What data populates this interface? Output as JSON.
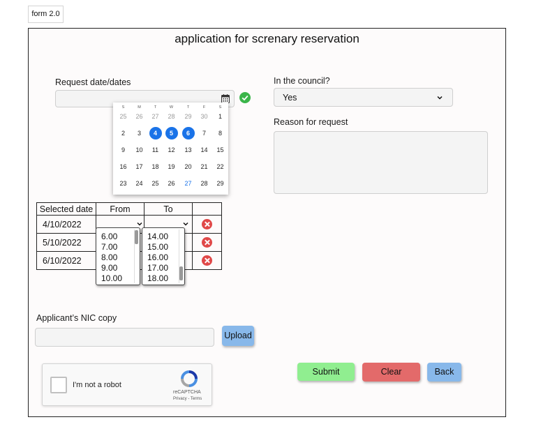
{
  "version_tag": "form 2.0",
  "title": "application for screnary reservation",
  "request_date": {
    "label": "Request date/dates",
    "value": ""
  },
  "council": {
    "label": "In the council?",
    "selected": "Yes"
  },
  "reason": {
    "label": "Reason for request",
    "value": ""
  },
  "calendar": {
    "weekdays": [
      "S",
      "M",
      "T",
      "W",
      "T",
      "F",
      "S"
    ],
    "rows": [
      [
        "25",
        "26",
        "27",
        "28",
        "29",
        "30",
        "1"
      ],
      [
        "2",
        "3",
        "4",
        "5",
        "6",
        "7",
        "8"
      ],
      [
        "9",
        "10",
        "11",
        "12",
        "13",
        "14",
        "15"
      ],
      [
        "16",
        "17",
        "18",
        "19",
        "20",
        "21",
        "22"
      ],
      [
        "23",
        "24",
        "25",
        "26",
        "27",
        "28",
        "29"
      ]
    ],
    "selected_days": [
      "4",
      "5",
      "6"
    ],
    "today": "27"
  },
  "table": {
    "headers": [
      "Selected date",
      "From",
      "To"
    ],
    "rows": [
      {
        "date": "4/10/2022"
      },
      {
        "date": "5/10/2022"
      },
      {
        "date": "6/10/2022"
      }
    ]
  },
  "from_options": [
    "6.00",
    "7.00",
    "8.00",
    "9.00",
    "10.00"
  ],
  "to_options": [
    "14.00",
    "15.00",
    "16.00",
    "17.00",
    "18.00"
  ],
  "nic": {
    "label": "Applicant’s NIC copy",
    "upload_label": "Upload"
  },
  "captcha": {
    "text": "I'm not a robot",
    "brand": "reCAPTCHA",
    "links": "Privacy - Terms"
  },
  "buttons": {
    "submit": "Submit",
    "clear": "Clear",
    "back": "Back"
  },
  "colors": {
    "submit": "#90ee90",
    "clear": "#e36a6a",
    "back_upload": "#88b8ea",
    "selected_day": "#1a73e8",
    "remove": "#e04848",
    "check": "#3bb54a"
  }
}
